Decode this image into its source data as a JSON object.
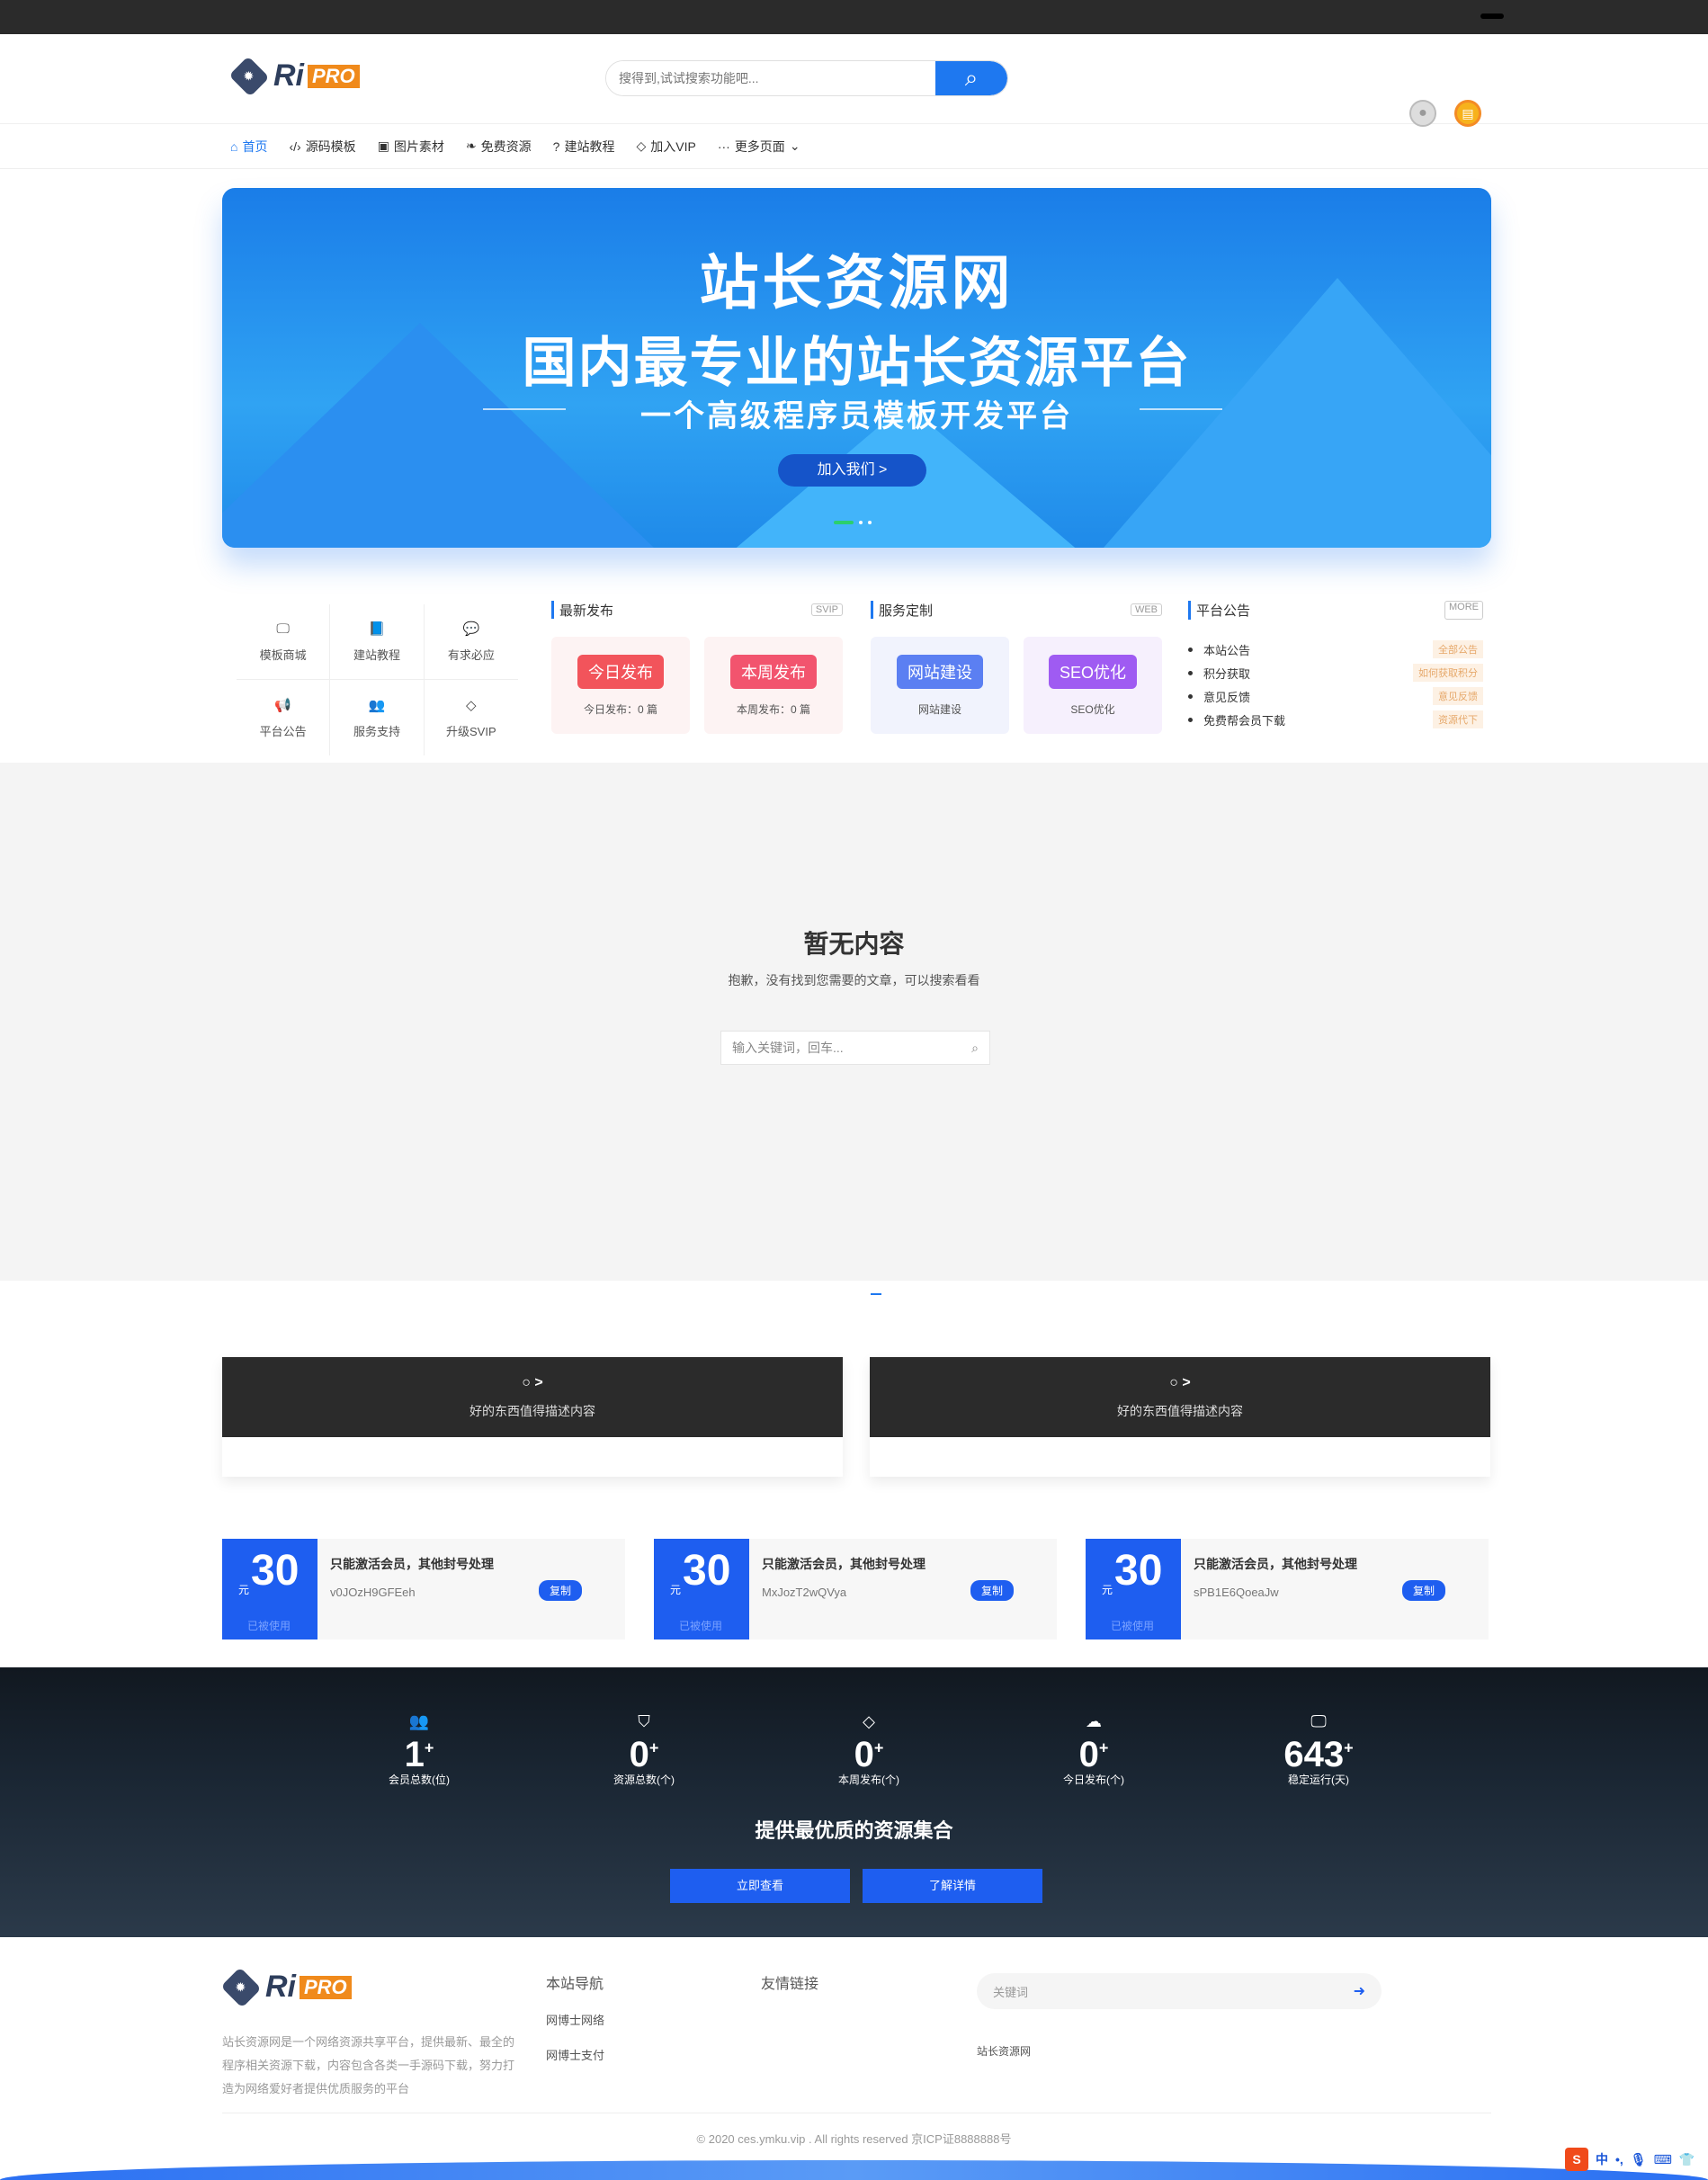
{
  "header": {
    "logo_ri": "Ri",
    "logo_pro": "PRO",
    "search_placeholder": "搜得到,试试搜索功能吧..."
  },
  "nav": [
    {
      "label": "首页",
      "icon": "home-icon",
      "active": true
    },
    {
      "label": "源码模板",
      "icon": "code-icon"
    },
    {
      "label": "图片素材",
      "icon": "image-icon"
    },
    {
      "label": "免费资源",
      "icon": "leaf-icon"
    },
    {
      "label": "建站教程",
      "icon": "question-icon"
    },
    {
      "label": "加入VIP",
      "icon": "diamond-icon"
    },
    {
      "label": "更多页面",
      "icon": "more-icon"
    }
  ],
  "banner": {
    "title": "站长资源网",
    "subtitle": "国内最专业的站长资源平台",
    "tagline": "一个高级程序员模板开发平台",
    "join_label": "加入我们 >"
  },
  "quick": [
    {
      "label": "模板商城",
      "icon": "monitor-icon",
      "glyph": "🖵"
    },
    {
      "label": "建站教程",
      "icon": "book-icon",
      "glyph": "📘"
    },
    {
      "label": "有求必应",
      "icon": "chat-icon",
      "glyph": "💬"
    },
    {
      "label": "平台公告",
      "icon": "megaphone-icon",
      "glyph": "📢"
    },
    {
      "label": "服务支持",
      "icon": "users-icon",
      "glyph": "👥"
    },
    {
      "label": "升级SVIP",
      "icon": "diamond-icon",
      "glyph": "◇"
    }
  ],
  "latest": {
    "title": "最新发布",
    "tag": "SVIP",
    "cards": [
      {
        "btn": "今日发布",
        "cap": "今日发布：0 篇",
        "color": "#f2545b"
      },
      {
        "btn": "本周发布",
        "cap": "本周发布：0 篇",
        "color": "#f2546e"
      }
    ]
  },
  "service": {
    "title": "服务定制",
    "tag": "WEB",
    "cards": [
      {
        "btn": "网站建设",
        "cap": "网站建设",
        "color": "#5b7ff2"
      },
      {
        "btn": "SEO优化",
        "cap": "SEO优化",
        "color": "#9f5bf2"
      }
    ]
  },
  "notice": {
    "title": "平台公告",
    "tag": "MORE",
    "items": [
      {
        "name": "本站公告",
        "badge": "全部公告"
      },
      {
        "name": "积分获取",
        "badge": "如何获取积分"
      },
      {
        "name": "意见反馈",
        "badge": "意见反馈"
      },
      {
        "name": "免费帮会员下载",
        "badge": "资源代下"
      }
    ]
  },
  "empty": {
    "title": "暂无内容",
    "desc": "抱歉，没有找到您需要的文章，可以搜索看看",
    "placeholder": "输入关键词，回车..."
  },
  "promos": [
    {
      "arrow": "○ >",
      "text": "好的东西值得描述内容"
    },
    {
      "arrow": "○ >",
      "text": "好的东西值得描述内容"
    }
  ],
  "coupons": [
    {
      "unit": "元",
      "amount": "30",
      "title": "只能激活会员，其他封号处理",
      "code": "v0JOzH9GFEeh",
      "copy": "复制",
      "status": "已被使用"
    },
    {
      "unit": "元",
      "amount": "30",
      "title": "只能激活会员，其他封号处理",
      "code": "MxJozT2wQVya",
      "copy": "复制",
      "status": "已被使用"
    },
    {
      "unit": "元",
      "amount": "30",
      "title": "只能激活会员，其他封号处理",
      "code": "sPB1E6QoeaJw",
      "copy": "复制",
      "status": "已被使用"
    }
  ],
  "stats": {
    "items": [
      {
        "num": "1",
        "label": "会员总数(位)",
        "icon": "users-icon",
        "glyph": "👥"
      },
      {
        "num": "0",
        "label": "资源总数(个)",
        "icon": "shield-icon",
        "glyph": "⛉"
      },
      {
        "num": "0",
        "label": "本周发布(个)",
        "icon": "diamond-icon",
        "glyph": "◇"
      },
      {
        "num": "0",
        "label": "今日发布(个)",
        "icon": "cloud-icon",
        "glyph": "☁"
      },
      {
        "num": "643",
        "label": "稳定运行(天)",
        "icon": "monitor-icon",
        "glyph": "🖵"
      }
    ],
    "slogan": "提供最优质的资源集合",
    "btn1": "立即查看",
    "btn2": "了解详情"
  },
  "footer": {
    "logo_ri": "Ri",
    "logo_pro": "PRO",
    "desc": "站长资源网是一个网络资源共享平台，提供最新、最全的程序相关资源下载，内容包含各类一手源码下载，努力打造为网络爱好者提供优质服务的平台",
    "nav_title": "本站导航",
    "nav_links": [
      "网博士网络",
      "网博士支付"
    ],
    "friend_title": "友情链接",
    "search_placeholder": "关键词",
    "site_link": "站长资源网",
    "copyright": "© 2020 ces.ymku.vip . All rights reserved  京ICP证8888888号"
  },
  "ime": {
    "s": "S",
    "zh": "中"
  }
}
